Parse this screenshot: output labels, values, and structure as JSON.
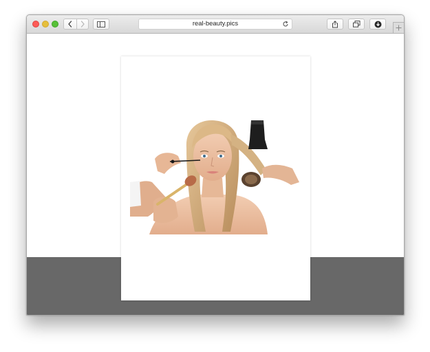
{
  "window": {
    "traffic_lights": [
      "close",
      "minimize",
      "zoom"
    ]
  },
  "toolbar": {
    "address": "real-beauty.pics",
    "icons": {
      "back": "chevron-left-icon",
      "forward": "chevron-right-icon",
      "sidebar": "sidebar-icon",
      "reload": "reload-icon",
      "share": "share-icon",
      "tabs": "tabs-icon",
      "download": "download-icon",
      "new_tab": "plus-icon"
    }
  },
  "page": {
    "background_band_color": "#686868",
    "image": {
      "subject": "beauty-makeover-photo"
    }
  }
}
